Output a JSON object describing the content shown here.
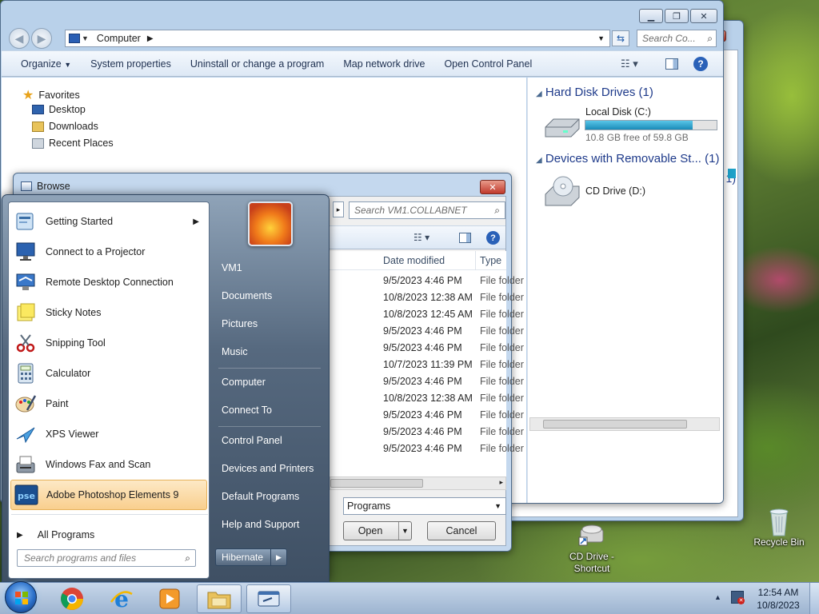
{
  "desktop": {
    "icons": [
      {
        "label_line1": "CD Drive -",
        "label_line2": "Shortcut"
      },
      {
        "label_line1": "Recycle Bin",
        "label_line2": ""
      }
    ]
  },
  "explorer": {
    "address": "Computer",
    "search_placeholder": "Search Co...",
    "commands": [
      "Organize",
      "System properties",
      "Uninstall or change a program",
      "Map network drive",
      "Open Control Panel"
    ],
    "favorites_label": "Favorites",
    "nav_items": [
      "Desktop",
      "Downloads",
      "Recent Places"
    ],
    "groups": [
      {
        "title": "Hard Disk Drives (1)"
      },
      {
        "title": "Devices with Removable St... (1)"
      }
    ],
    "drives": [
      {
        "name": "Local Disk (C:)",
        "free_text": "10.8 GB free of 59.8 GB",
        "used_fraction": 0.82
      },
      {
        "name": "CD Drive (D:)"
      }
    ]
  },
  "browse": {
    "title": "Browse",
    "search_placeholder": "Search VM1.COLLABNET",
    "columns": [
      "Date modified",
      "Type"
    ],
    "rows": [
      {
        "date": "9/5/2023 4:46 PM",
        "type": "File folder"
      },
      {
        "date": "10/8/2023 12:38 AM",
        "type": "File folder"
      },
      {
        "date": "10/8/2023 12:45 AM",
        "type": "File folder"
      },
      {
        "date": "9/5/2023 4:46 PM",
        "type": "File folder"
      },
      {
        "date": "9/5/2023 4:46 PM",
        "type": "File folder"
      },
      {
        "date": "10/7/2023 11:39 PM",
        "type": "File folder"
      },
      {
        "date": "9/5/2023 4:46 PM",
        "type": "File folder"
      },
      {
        "date": "10/8/2023 12:38 AM",
        "type": "File folder"
      },
      {
        "date": "9/5/2023 4:46 PM",
        "type": "File folder"
      },
      {
        "date": "9/5/2023 4:46 PM",
        "type": "File folder"
      },
      {
        "date": "9/5/2023 4:46 PM",
        "type": "File folder"
      }
    ],
    "filter_value": "Programs",
    "open_label": "Open",
    "cancel_label": "Cancel"
  },
  "start_menu": {
    "programs": [
      {
        "label": "Getting Started",
        "icon": "getting-started-icon"
      },
      {
        "label": "Connect to a Projector",
        "icon": "projector-icon"
      },
      {
        "label": "Remote Desktop Connection",
        "icon": "remote-desktop-icon"
      },
      {
        "label": "Sticky Notes",
        "icon": "sticky-notes-icon"
      },
      {
        "label": "Snipping Tool",
        "icon": "scissors-icon"
      },
      {
        "label": "Calculator",
        "icon": "calculator-icon"
      },
      {
        "label": "Paint",
        "icon": "paint-palette-icon"
      },
      {
        "label": "XPS Viewer",
        "icon": "xps-viewer-icon"
      },
      {
        "label": "Windows Fax and Scan",
        "icon": "fax-icon"
      },
      {
        "label": "Adobe Photoshop Elements 9",
        "icon": "photoshop-elements-icon"
      }
    ],
    "pse_glyph": "pse",
    "all_programs": "All Programs",
    "search_placeholder": "Search programs and files",
    "right_items": [
      "VM1",
      "Documents",
      "Pictures",
      "Music",
      "Computer",
      "Connect To",
      "Control Panel",
      "Devices and Printers",
      "Default Programs",
      "Help and Support"
    ],
    "shutdown_label": "Hibernate"
  },
  "taskbar": {
    "time": "12:54 AM",
    "date": "10/8/2023"
  },
  "colors": {
    "accent": "#1e3a8a",
    "highlight": "#f9cf8e",
    "drive_bar": "#1ea1c8"
  }
}
